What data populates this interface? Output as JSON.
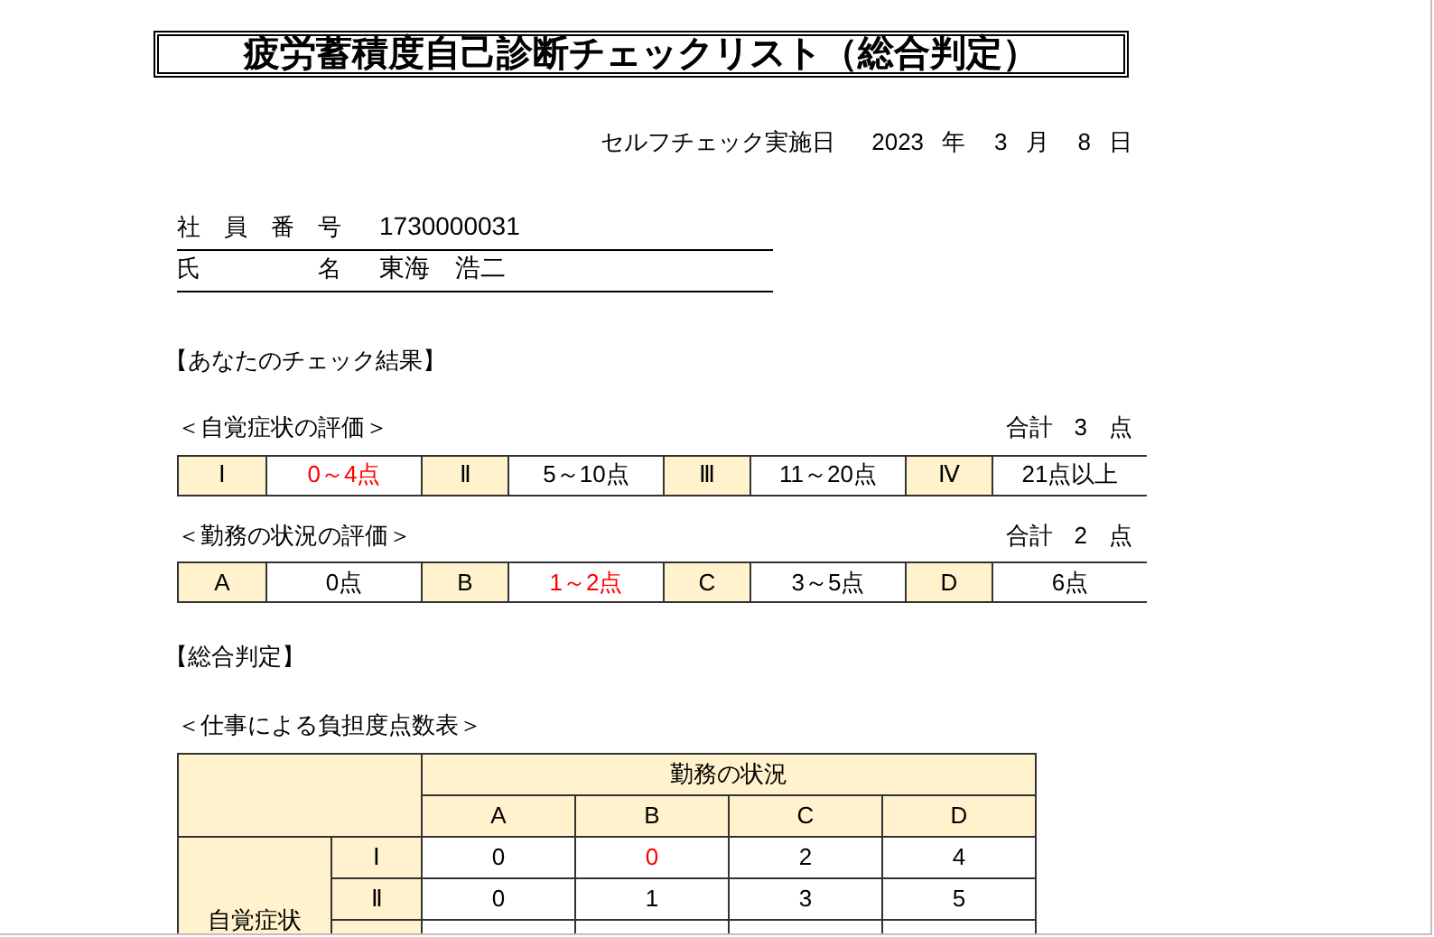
{
  "title": "疲労蓄積度自己診断チェックリスト（総合判定）",
  "check_date": {
    "label": "セルフチェック実施日",
    "year": "2023",
    "year_unit": "年",
    "month": "3",
    "month_unit": "月",
    "day": "8",
    "day_unit": "日"
  },
  "employee": [
    {
      "label": "社　員　番　号",
      "value": "1730000031"
    },
    {
      "label": "氏　　　　　名",
      "value": "東海　浩二"
    }
  ],
  "result_heading": "【あなたのチェック結果】",
  "scales": [
    {
      "title": "＜自覚症状の評価＞",
      "total_label": "合計",
      "total": "3",
      "total_unit": "点",
      "ranges": [
        {
          "grade": "Ⅰ",
          "range": "0～4点",
          "selected": true
        },
        {
          "grade": "Ⅱ",
          "range": "5～10点",
          "selected": false
        },
        {
          "grade": "Ⅲ",
          "range": "11～20点",
          "selected": false
        },
        {
          "grade": "Ⅳ",
          "range": "21点以上",
          "selected": false
        }
      ]
    },
    {
      "title": "＜勤務の状況の評価＞",
      "total_label": "合計",
      "total": "2",
      "total_unit": "点",
      "ranges": [
        {
          "grade": "A",
          "range": "0点",
          "selected": false
        },
        {
          "grade": "B",
          "range": "1～2点",
          "selected": true
        },
        {
          "grade": "C",
          "range": "3～5点",
          "selected": false
        },
        {
          "grade": "D",
          "range": "6点",
          "selected": false
        }
      ]
    }
  ],
  "overall_heading": "【総合判定】",
  "matrix": {
    "title": "＜仕事による負担度点数表＞",
    "column_group": "勤務の状況",
    "columns": [
      "A",
      "B",
      "C",
      "D"
    ],
    "row_group": "自覚症状",
    "rows": [
      {
        "grade": "Ⅰ",
        "cells": [
          {
            "value": "0",
            "selected": false
          },
          {
            "value": "0",
            "selected": true
          },
          {
            "value": "2",
            "selected": false
          },
          {
            "value": "4",
            "selected": false
          }
        ]
      },
      {
        "grade": "Ⅱ",
        "cells": [
          {
            "value": "0",
            "selected": false
          },
          {
            "value": "1",
            "selected": false
          },
          {
            "value": "3",
            "selected": false
          },
          {
            "value": "5",
            "selected": false
          }
        ]
      }
    ]
  }
}
